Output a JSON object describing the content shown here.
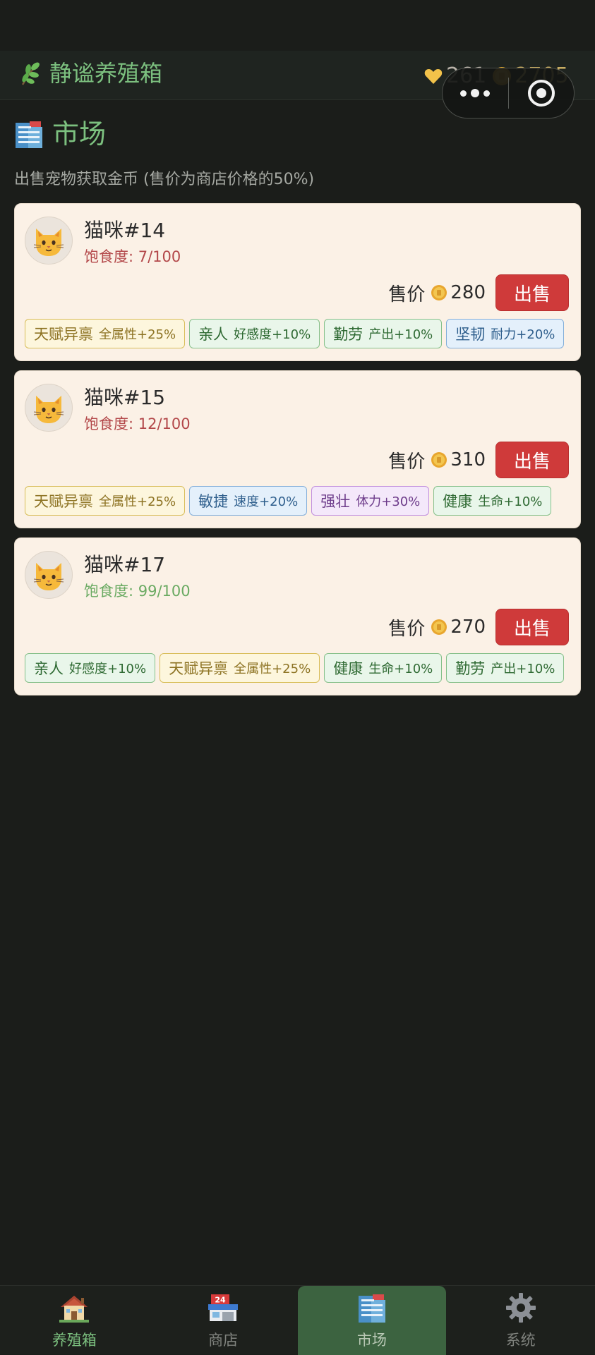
{
  "header": {
    "title": "静谧养殖箱",
    "hearts": "261",
    "coins": "2705"
  },
  "market": {
    "title": "市场",
    "subtitle": "出售宠物获取金币 (售价为商店价格的50%)",
    "price_label": "售价",
    "sell_label": "出售",
    "pets": [
      {
        "name": "猫咪#14",
        "satiety": "饱食度: 7/100",
        "price": "280",
        "tags": [
          {
            "name": "天赋异禀",
            "effect": "全属性+25%",
            "color": "gold"
          },
          {
            "name": "亲人",
            "effect": "好感度+10%",
            "color": "green"
          },
          {
            "name": "勤劳",
            "effect": "产出+10%",
            "color": "green"
          },
          {
            "name": "坚韧",
            "effect": "耐力+20%",
            "color": "blue"
          }
        ]
      },
      {
        "name": "猫咪#15",
        "satiety": "饱食度: 12/100",
        "price": "310",
        "tags": [
          {
            "name": "天赋异禀",
            "effect": "全属性+25%",
            "color": "gold"
          },
          {
            "name": "敏捷",
            "effect": "速度+20%",
            "color": "blue"
          },
          {
            "name": "强壮",
            "effect": "体力+30%",
            "color": "purple"
          },
          {
            "name": "健康",
            "effect": "生命+10%",
            "color": "green"
          }
        ]
      },
      {
        "name": "猫咪#17",
        "satiety": "饱食度: 99/100",
        "price": "270",
        "tags": [
          {
            "name": "亲人",
            "effect": "好感度+10%",
            "color": "green"
          },
          {
            "name": "天赋异禀",
            "effect": "全属性+25%",
            "color": "gold"
          },
          {
            "name": "健康",
            "effect": "生命+10%",
            "color": "green"
          },
          {
            "name": "勤劳",
            "effect": "产出+10%",
            "color": "green"
          }
        ]
      }
    ]
  },
  "nav": {
    "items": [
      {
        "label": "养殖箱",
        "icon": "house-icon"
      },
      {
        "label": "商店",
        "icon": "store-icon"
      },
      {
        "label": "市场",
        "icon": "market-building-icon"
      },
      {
        "label": "系统",
        "icon": "gear-icon"
      }
    ],
    "active": "市场"
  }
}
